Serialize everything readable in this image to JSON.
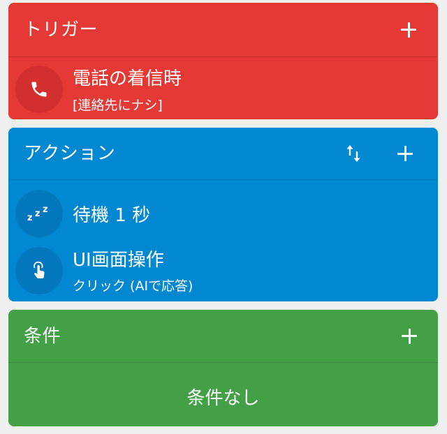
{
  "trigger": {
    "title": "トリガー",
    "add_icon": "plus-icon",
    "items": [
      {
        "icon": "phone-icon",
        "title": "電話の着信時",
        "subtitle": "[連絡先にナシ]"
      }
    ],
    "color": "#e53935"
  },
  "action": {
    "title": "アクション",
    "reorder_icon": "swap-vertical-icon",
    "add_icon": "plus-icon",
    "items": [
      {
        "icon": "sleep-zzz-icon",
        "title": "待機 1 秒"
      },
      {
        "icon": "touch-tap-icon",
        "title": "UI画面操作",
        "subtitle": "クリック (AIで応答)"
      }
    ],
    "color": "#0288d1"
  },
  "condition": {
    "title": "条件",
    "add_icon": "plus-icon",
    "empty_text": "条件なし",
    "color": "#43a047"
  }
}
